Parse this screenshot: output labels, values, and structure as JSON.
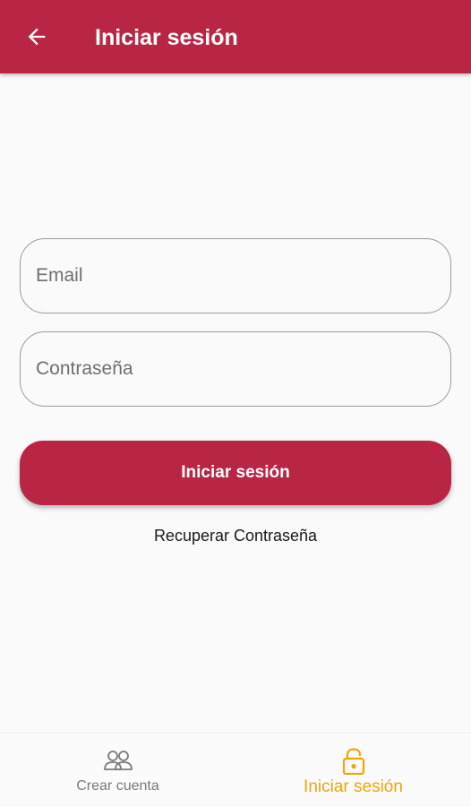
{
  "header": {
    "title": "Iniciar sesión",
    "back_icon": "arrow-left-icon",
    "background_color": "#b92643"
  },
  "form": {
    "email_placeholder": "Email",
    "password_placeholder": "Contraseña",
    "submit_label": "Iniciar sesión",
    "recover_label": "Recuperar Contraseña",
    "accent_color": "#b92643"
  },
  "bottom_nav": {
    "items": [
      {
        "label": "Crear cuenta",
        "icon": "people-icon",
        "active": false,
        "color": "#7a7a7a"
      },
      {
        "label": "Iniciar sesión",
        "icon": "unlock-icon",
        "active": true,
        "color": "#f0a40d"
      }
    ]
  }
}
